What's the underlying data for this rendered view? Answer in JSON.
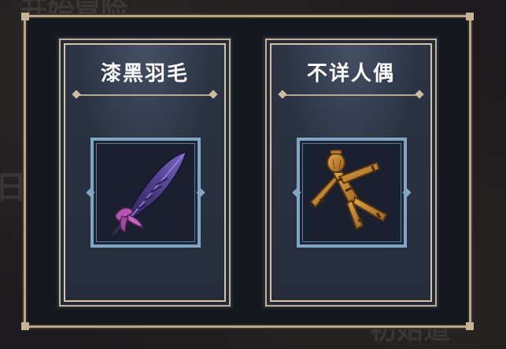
{
  "background": {
    "title_fragment": "开始冒险",
    "side_fragment": "日影",
    "bottom_fragment": "初始道"
  },
  "cards": [
    {
      "title": "漆黑羽毛",
      "icon": "black-feather-icon"
    },
    {
      "title": "不详人偶",
      "icon": "straw-voodoo-doll-icon"
    }
  ],
  "colors": {
    "frame_gold": "#c4b092",
    "card_bg": "#2c3445",
    "item_frame_blue": "#7fa6c4",
    "title_text": "#ffffff"
  }
}
